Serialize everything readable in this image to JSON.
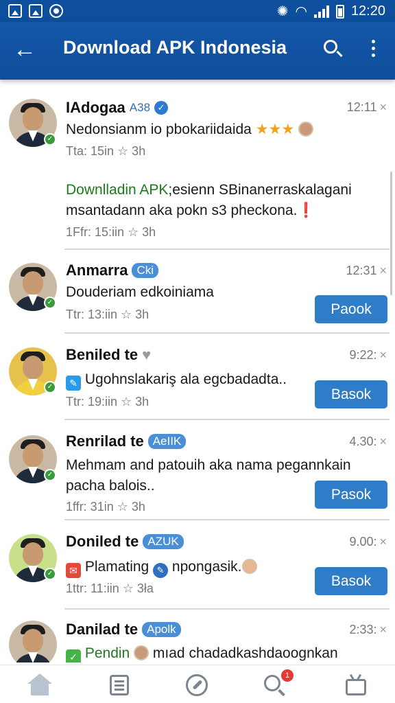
{
  "status_bar": {
    "time": "12:20"
  },
  "app_bar": {
    "title": "Download APK Indonesia"
  },
  "posts": [
    {
      "name": "IAdogaa",
      "tag": "A38",
      "time": "12:11",
      "body_text": "Nedonsianm io pbokariidaida",
      "stars": "★★★",
      "meta": "Tta: 15in ☆ 3h"
    },
    {
      "body_green": "Downlladin APK",
      "body_rest": ";esienn SBinanerraskalagani msantadann aka pokn s3 pheckona.",
      "emoji": "❗",
      "meta": "1Ffr: 15:iin ☆ 3h"
    },
    {
      "name": "Anmarra",
      "tag": "Cki",
      "time": "12:31",
      "body_text": "Douderiam edkoiniama",
      "meta": "Ttr: 13:iin ☆ 3h",
      "button": "Paook"
    },
    {
      "name": "Beniled te",
      "time": "9:22:",
      "body_text": "Ugohnslakariş ala egcbadadta..",
      "meta": "Ttr: 19:iin ☆ 3h",
      "button": "Basok"
    },
    {
      "name": "Renrilad te",
      "tag": "AeIIK",
      "time": "4.30:",
      "body_text": "Mehmam and patouih aka nama pegannkain pacha balois..",
      "meta": "1ffr: 31in ☆ 3h",
      "button": "Pasok"
    },
    {
      "name": "Doniled te",
      "tag": "AZUK",
      "time": "9.00:",
      "body_text_1": "Plamating",
      "body_text_2": "npongasik.",
      "meta": "1ttr: 11:iin ☆ 3ła",
      "button": "Basok"
    },
    {
      "name": "Danilad te",
      "tag": "Apolk",
      "time": "2:33:",
      "body_green": "Pendin",
      "body_rest": "mıad chadadkashdaoognkan"
    }
  ],
  "icons": {
    "close": "×",
    "back": "←",
    "notification_count": "1"
  },
  "colors": {
    "app_bar": "#0d4f9c",
    "button": "#2f7dc8",
    "tag": "#4a8fd6",
    "green_text": "#1e7a1e",
    "badge": "#e53935"
  }
}
